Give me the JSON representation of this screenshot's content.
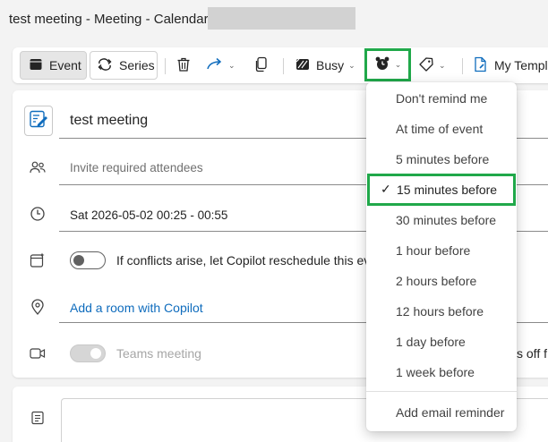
{
  "window": {
    "title": "test meeting - Meeting - Calendar - "
  },
  "toolbar": {
    "event_label": "Event",
    "series_label": "Series",
    "busy_label": "Busy",
    "templates_label": "My Templates"
  },
  "form": {
    "subject": "test meeting",
    "attendees_placeholder": "Invite required attendees",
    "datetime": "Sat 2026-05-02 00:25 - 00:55",
    "copilot_text": "If conflicts arise, let Copilot reschedule this event",
    "room_link": "Add a room with Copilot",
    "teams_label": "Teams meeting",
    "teams_right_fragment": "s off f"
  },
  "reminder_menu": {
    "items": [
      "Don't remind me",
      "At time of event",
      "5 minutes before",
      "15 minutes before",
      "30 minutes before",
      "1 hour before",
      "2 hours before",
      "12 hours before",
      "1 day before",
      "1 week before"
    ],
    "selected": "15 minutes before",
    "email_reminder": "Add email reminder"
  },
  "colors": {
    "accent_link": "#0f6cbd",
    "highlight_green": "#20a84a",
    "subject_icon_blue": "#0f6cbd"
  }
}
